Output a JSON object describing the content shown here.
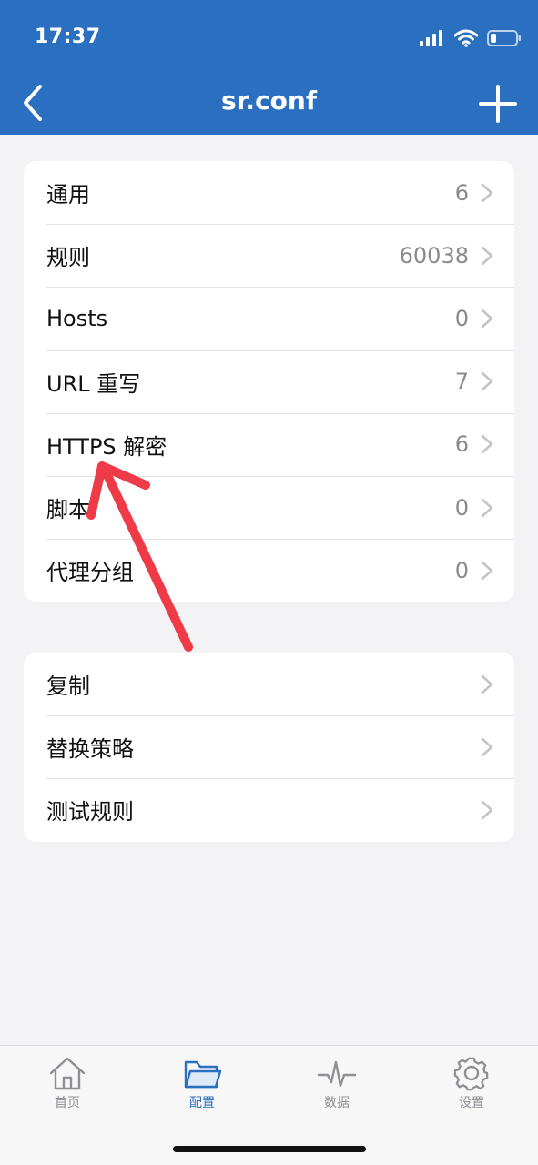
{
  "status": {
    "time": "17:37"
  },
  "nav": {
    "title": "sr.conf"
  },
  "section_main": [
    {
      "label": "通用",
      "value": "6"
    },
    {
      "label": "规则",
      "value": "60038"
    },
    {
      "label": "Hosts",
      "value": "0"
    },
    {
      "label": "URL 重写",
      "value": "7"
    },
    {
      "label": "HTTPS 解密",
      "value": "6"
    },
    {
      "label": "脚本",
      "value": "0"
    },
    {
      "label": "代理分组",
      "value": "0"
    }
  ],
  "section_actions": [
    {
      "label": "复制"
    },
    {
      "label": "替换策略"
    },
    {
      "label": "测试规则"
    }
  ],
  "tabs": [
    {
      "label": "首页",
      "icon": "home-icon"
    },
    {
      "label": "配置",
      "icon": "folder-icon"
    },
    {
      "label": "数据",
      "icon": "pulse-icon"
    },
    {
      "label": "设置",
      "icon": "gear-icon"
    }
  ],
  "colors": {
    "accent": "#2b6fc0",
    "annotation": "#ef3b47"
  }
}
